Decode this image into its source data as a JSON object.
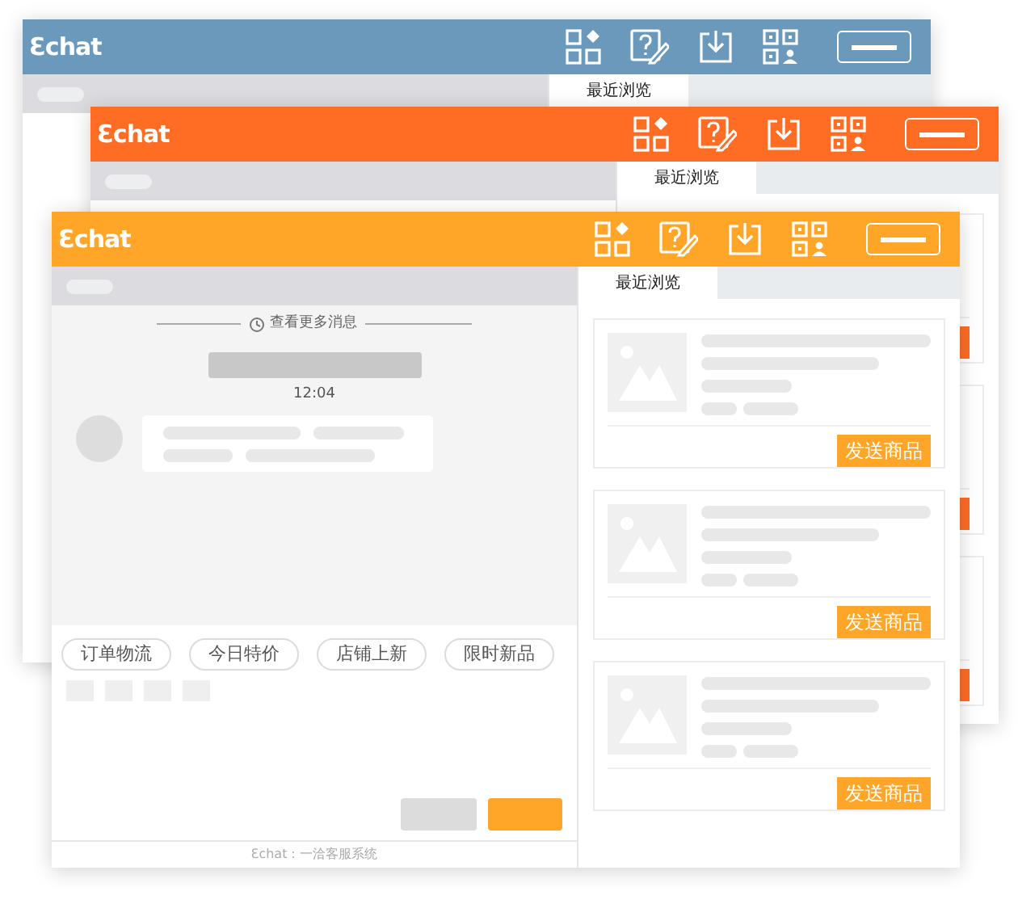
{
  "windows": [
    {
      "kind": "back",
      "color": "#6a99bb",
      "logo": "Ɛchat",
      "tab": "最近浏览"
    },
    {
      "kind": "back",
      "color": "#ff6c24",
      "logo": "Ɛchat",
      "tab": "最近浏览",
      "product_cards": [
        {
          "kind": "product"
        },
        {
          "kind": "product"
        },
        {
          "kind": "product"
        }
      ]
    },
    {
      "kind": "front",
      "color": "#ffa628",
      "logo": "Ɛchat",
      "tab": "最近浏览",
      "history_link": "查看更多消息",
      "time": "12:04",
      "quick_replies": [
        "订单物流",
        "今日特价",
        "店铺上新",
        "限时新品"
      ],
      "footer": "Ɛchat：一洽客服系统",
      "product_cards": [
        {
          "kind": "product",
          "button": "发送商品"
        },
        {
          "kind": "product",
          "button": "发送商品"
        },
        {
          "kind": "product",
          "button": "发送商品"
        }
      ]
    }
  ]
}
